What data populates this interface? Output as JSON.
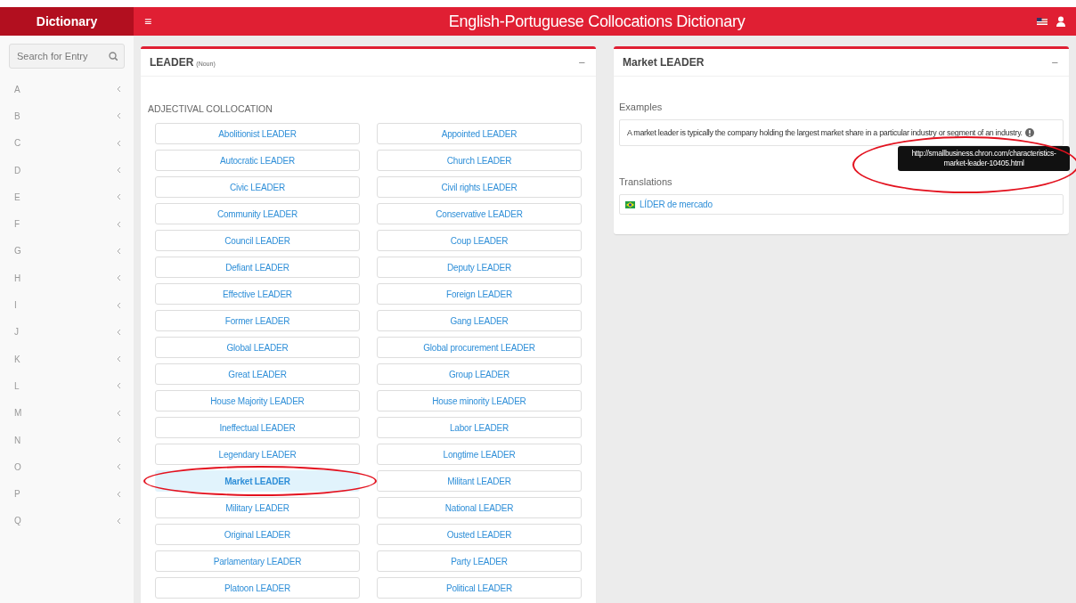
{
  "topbar": {
    "brand": "Dictionary",
    "menu_icon": "≡",
    "title": "English-Portuguese Collocations Dictionary"
  },
  "sidebar": {
    "search": {
      "placeholder": "Search for Entry"
    },
    "letters": [
      {
        "label": "A",
        "expanded": false
      },
      {
        "label": "B",
        "expanded": false
      },
      {
        "label": "C",
        "expanded": false
      },
      {
        "label": "D",
        "expanded": false
      },
      {
        "label": "E",
        "expanded": false
      },
      {
        "label": "F",
        "expanded": false
      },
      {
        "label": "G",
        "expanded": false
      },
      {
        "label": "H",
        "expanded": false
      },
      {
        "label": "I",
        "expanded": false
      },
      {
        "label": "J",
        "expanded": false
      },
      {
        "label": "K",
        "expanded": false
      },
      {
        "label": "L",
        "expanded": false
      },
      {
        "label": "M",
        "expanded": false
      },
      {
        "label": "N",
        "expanded": false
      },
      {
        "label": "O",
        "expanded": false
      },
      {
        "label": "P",
        "expanded": false
      },
      {
        "label": "Q",
        "expanded": false
      }
    ]
  },
  "entry_panel": {
    "headword": "LEADER",
    "pos": "(Noun)",
    "collapse_icon": "−",
    "section": "ADJECTIVAL COLLOCATION",
    "collocations": [
      {
        "label": "Abolitionist LEADER",
        "selected": false,
        "circled": false
      },
      {
        "label": "Appointed LEADER",
        "selected": false,
        "circled": false
      },
      {
        "label": "Autocratic LEADER",
        "selected": false,
        "circled": false
      },
      {
        "label": "Church LEADER",
        "selected": false,
        "circled": false
      },
      {
        "label": "Civic LEADER",
        "selected": false,
        "circled": false
      },
      {
        "label": "Civil rights LEADER",
        "selected": false,
        "circled": false
      },
      {
        "label": "Community LEADER",
        "selected": false,
        "circled": false
      },
      {
        "label": "Conservative LEADER",
        "selected": false,
        "circled": false
      },
      {
        "label": "Council LEADER",
        "selected": false,
        "circled": false
      },
      {
        "label": "Coup LEADER",
        "selected": false,
        "circled": false
      },
      {
        "label": "Defiant LEADER",
        "selected": false,
        "circled": false
      },
      {
        "label": "Deputy LEADER",
        "selected": false,
        "circled": false
      },
      {
        "label": "Effective LEADER",
        "selected": false,
        "circled": false
      },
      {
        "label": "Foreign LEADER",
        "selected": false,
        "circled": false
      },
      {
        "label": "Former LEADER",
        "selected": false,
        "circled": false
      },
      {
        "label": "Gang LEADER",
        "selected": false,
        "circled": false
      },
      {
        "label": "Global LEADER",
        "selected": false,
        "circled": false
      },
      {
        "label": "Global procurement LEADER",
        "selected": false,
        "circled": false
      },
      {
        "label": "Great LEADER",
        "selected": false,
        "circled": false
      },
      {
        "label": "Group LEADER",
        "selected": false,
        "circled": false
      },
      {
        "label": "House Majority LEADER",
        "selected": false,
        "circled": false
      },
      {
        "label": "House minority LEADER",
        "selected": false,
        "circled": false
      },
      {
        "label": "Ineffectual LEADER",
        "selected": false,
        "circled": false
      },
      {
        "label": "Labor LEADER",
        "selected": false,
        "circled": false
      },
      {
        "label": "Legendary LEADER",
        "selected": false,
        "circled": false
      },
      {
        "label": "Longtime LEADER",
        "selected": false,
        "circled": false
      },
      {
        "label": "Market LEADER",
        "selected": true,
        "circled": true
      },
      {
        "label": "Militant LEADER",
        "selected": false,
        "circled": false
      },
      {
        "label": "Military LEADER",
        "selected": false,
        "circled": false
      },
      {
        "label": "National LEADER",
        "selected": false,
        "circled": false
      },
      {
        "label": "Original LEADER",
        "selected": false,
        "circled": false
      },
      {
        "label": "Ousted LEADER",
        "selected": false,
        "circled": false
      },
      {
        "label": "Parlamentary LEADER",
        "selected": false,
        "circled": false
      },
      {
        "label": "Party LEADER",
        "selected": false,
        "circled": false
      },
      {
        "label": "Platoon LEADER",
        "selected": false,
        "circled": false
      },
      {
        "label": "Political LEADER",
        "selected": false,
        "circled": false
      }
    ]
  },
  "detail_panel": {
    "title": "Market LEADER",
    "collapse_icon": "−",
    "examples_heading": "Examples",
    "example": "A market leader is typically the company holding the largest market share in a particular industry or segment of an industry.",
    "source_tooltip": {
      "text": "http://smallbusiness.chron.com/characteristics-market-leader-10405.html",
      "circled": true
    },
    "translations_heading": "Translations",
    "translations": [
      {
        "label": "LÍDER de mercado"
      }
    ]
  }
}
